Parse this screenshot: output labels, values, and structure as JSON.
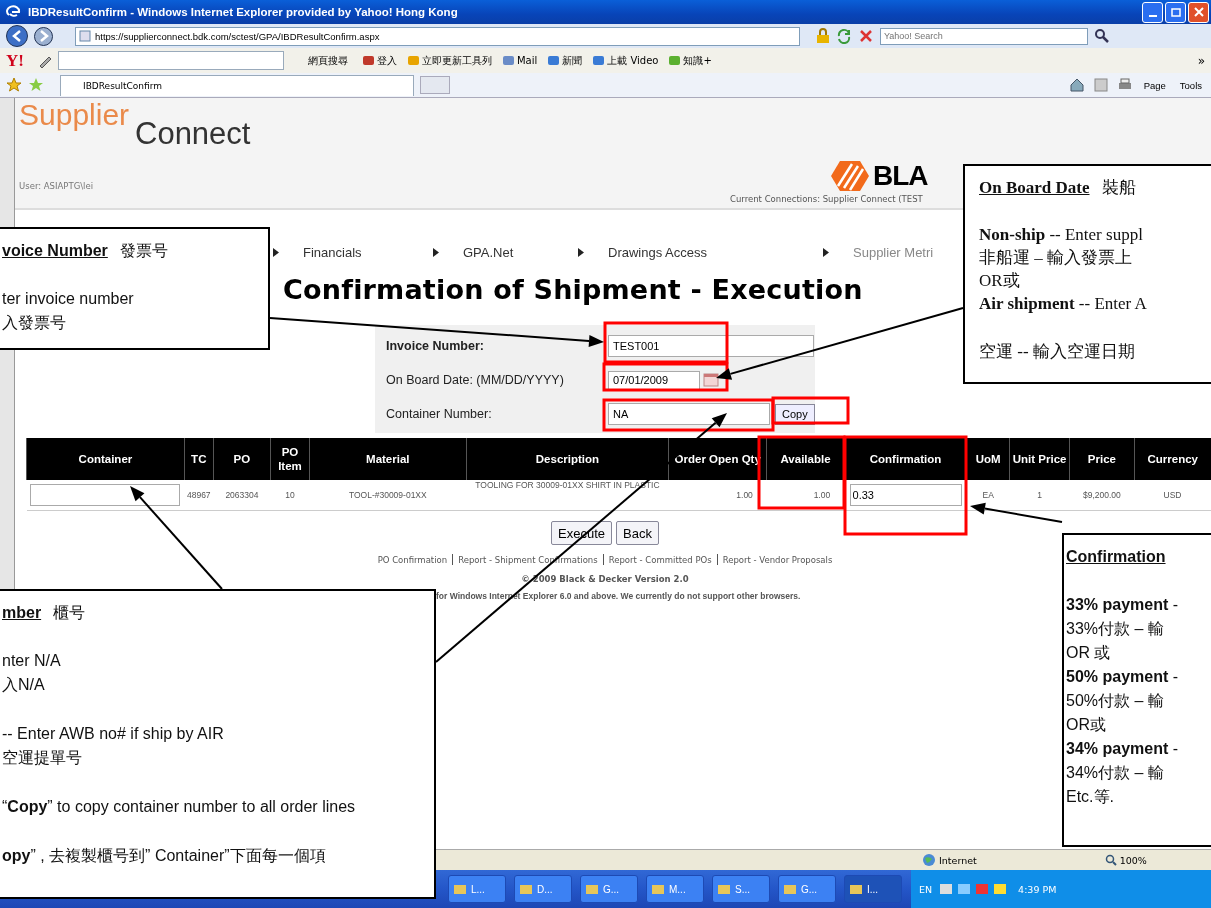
{
  "window": {
    "title": "IBDResultConfirm - Windows Internet Explorer provided by Yahoo! Hong Kong"
  },
  "address_bar": {
    "url": "https://supplierconnect.bdk.com/sctest/GPA/IBDResultConfirm.aspx",
    "search_placeholder": "Yahoo! Search"
  },
  "yahoo_toolbar": {
    "logo": "Y!",
    "search_button": "網頁搜尋",
    "items": [
      "登入",
      "立即更新工具列",
      "Mail",
      "新聞",
      "上載 Video",
      "知識+"
    ],
    "more": "»"
  },
  "tabs": [
    {
      "title": "IBDResultConfirm"
    }
  ],
  "command_bar": [
    "Page",
    "Tools"
  ],
  "page": {
    "logo_first": "Supplier",
    "logo_second": "Connect",
    "user": "User: ASIAPTG\\lei",
    "brand": "BLA",
    "connections": "Current Connections: Supplier Connect (TEST",
    "nav": [
      "Financials",
      "GPA.Net",
      "Drawings Access",
      "Supplier Metri"
    ],
    "heading": "Confirmation of Shipment - Execution",
    "form": {
      "invoice_label": "Invoice Number:",
      "invoice_value": "TEST001",
      "date_label": "On Board Date: (MM/DD/YYYY)",
      "date_value": "07/01/2009",
      "container_label": "Container Number:",
      "container_value": "NA",
      "copy_button": "Copy"
    },
    "table": {
      "columns": [
        "Container",
        "TC",
        "PO",
        "PO Item",
        "Material",
        "Description",
        "Order Open Qty",
        "Available",
        "Confirmation",
        "UoM",
        "Unit Price",
        "Price",
        "Currency"
      ],
      "rows": [
        {
          "tc": "48967",
          "po": "2063304",
          "po_item": "10",
          "material": "TOOL-#30009-01XX",
          "description": "TOOLING FOR 30009-01XX SHIRT IN PLASTIC",
          "order_open_qty": "1.00",
          "available": "1.00",
          "confirmation": "0.33",
          "uom": "EA",
          "unit_price": "1",
          "price": "$9,200.00",
          "currency": "USD"
        }
      ]
    },
    "buttons": [
      "Execute",
      "Back"
    ],
    "links": [
      "PO Confirmation",
      "Report - Shipment Confirmations",
      "Report - Committed POs",
      "Report - Vendor Proposals"
    ],
    "copyright": "© 2009 Black & Decker Version 2.0",
    "browser_note": "for Windows Internet Explorer 6.0 and above. We currently do not support other browsers."
  },
  "callouts": [
    {
      "kind": "sans",
      "title": "voice Number",
      "note": "發票号",
      "paragraphs": [
        [
          "ter invoice number",
          "入發票号"
        ]
      ]
    },
    {
      "kind": "serif",
      "title": "On Board Date",
      "note": "裝船",
      "paragraphs": [
        [
          "**Non-ship** -- Enter suppl",
          "非船運 – 輸入發票上",
          "OR或",
          "**Air shipment** -- Enter A"
        ],
        [
          "空運 -- 輸入空運日期"
        ]
      ]
    },
    {
      "kind": "sans",
      "title": "mber",
      "note": "櫃号",
      "paragraphs": [
        [
          "nter N/A",
          "入N/A"
        ],
        [
          "-- Enter AWB no# if ship by AIR",
          "空運提單号"
        ],
        [
          "“**Copy**” to copy container number to all order lines"
        ],
        [
          "**opy**” , 去複製櫃号到” Container”下面每一個項"
        ]
      ]
    },
    {
      "kind": "sans",
      "title": "Confirmation",
      "paragraphs": [
        [
          "**33% payment** -",
          "33%付款 – 輸",
          "OR 或",
          "**50% payment** -",
          "50%付款 – 輸",
          "OR或",
          "**34% payment** -",
          "34%付款 – 輸",
          "Etc.等."
        ]
      ]
    }
  ],
  "status_bar": {
    "zone": "Internet",
    "zoom": "100%"
  },
  "taskbar": {
    "buttons": [
      {
        "label": "L...",
        "selected": false
      },
      {
        "label": "D...",
        "selected": false
      },
      {
        "label": "G...",
        "selected": false
      },
      {
        "label": "M...",
        "selected": false
      },
      {
        "label": "S...",
        "selected": false
      },
      {
        "label": "G...",
        "selected": false
      },
      {
        "label": "I...",
        "selected": true
      }
    ],
    "language": "EN",
    "clock": "4:39 PM"
  }
}
